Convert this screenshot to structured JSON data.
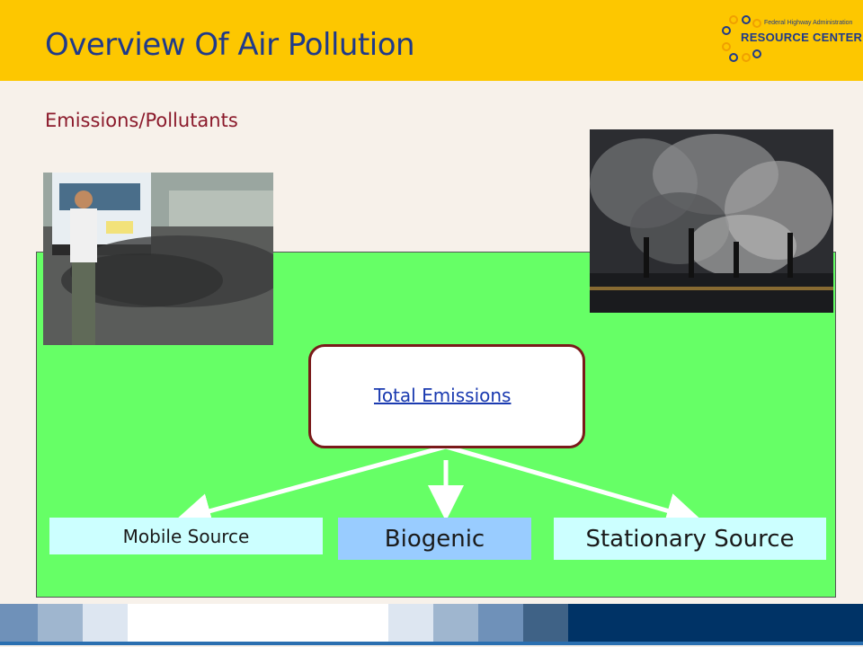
{
  "header": {
    "title": "Overview Of Air Pollution",
    "logo": {
      "agency": "Federal Highway Administration",
      "name": "RESOURCE CENTER"
    }
  },
  "subtitle": "Emissions/Pollutants",
  "diagram": {
    "root": "Total Emissions",
    "sources": {
      "mobile": "Mobile Source",
      "biogenic": "Biogenic",
      "stationary": "Stationary Source"
    }
  },
  "images": {
    "left": "bus-exhaust-photo",
    "right": "factory-smokestacks-photo"
  },
  "colors": {
    "header": "#fdc700",
    "title": "#1f3a8a",
    "subtitle": "#8b1a2b",
    "panel": "#66ff66",
    "box_border": "#7a1a1a",
    "mobile_box": "#ccffff",
    "biogenic_box": "#99ccff",
    "stationary_box": "#ccffff",
    "footer": [
      "#6f91b9",
      "#9fb6cf",
      "#dde6f1",
      "#ffffff",
      "#dde6f1",
      "#9fb6cf",
      "#6f91b9",
      "#3f6286",
      "#003366"
    ]
  }
}
